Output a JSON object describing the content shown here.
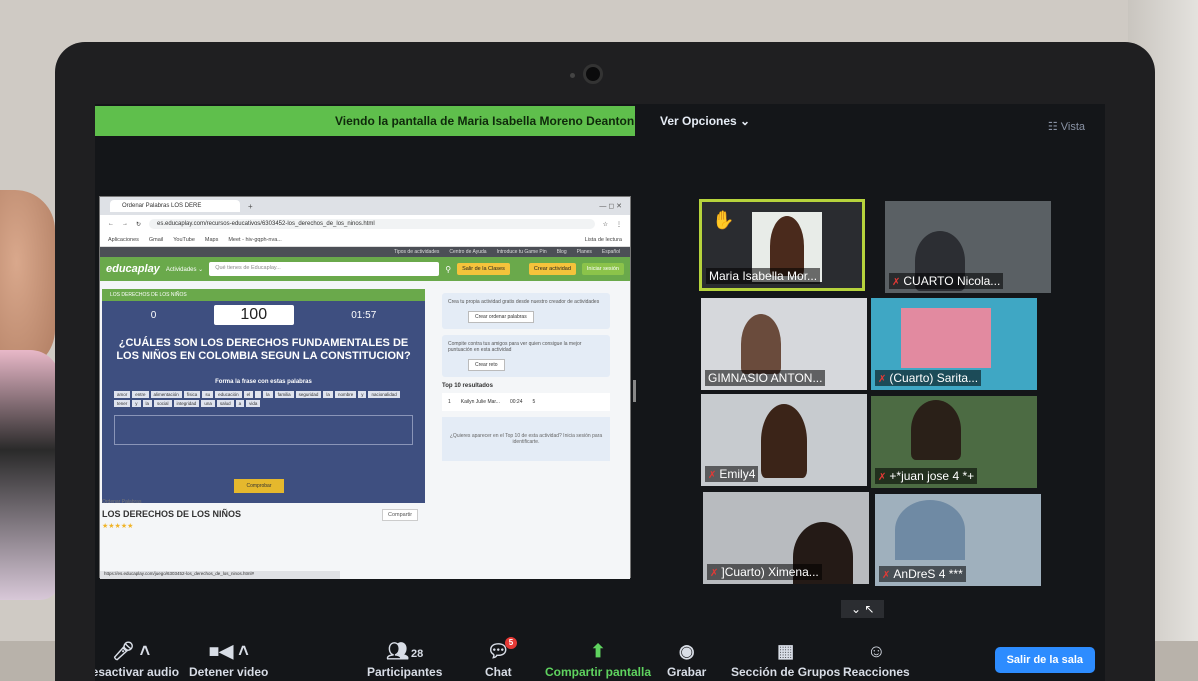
{
  "zoom": {
    "share_banner": "Viendo la pantalla de Maria Isabella Moreno Deantoni...",
    "view_options": "Ver Opciones ⌄",
    "view_label": "Vista"
  },
  "browser": {
    "tab_title": "Ordenar Palabras LOS DERE",
    "url": "es.educaplay.com/recursos-educativos/6303452-los_derechos_de_los_ninos.html",
    "bookmarks": [
      "Aplicaciones",
      "Gmail",
      "YouTube",
      "Maps",
      "Meet - hiv-gqph-nva..."
    ],
    "reading_list": "Lista de lectura",
    "status_url": "https://es.educaplay.com/juego/6303452-los_derechos_de_los_ninos.html#"
  },
  "site": {
    "top_links": [
      "Tipos de actividades",
      "Centro de Ayuda",
      "Introduce tu Game Pin",
      "Blog",
      "Planes",
      "Español"
    ],
    "logo": "educaplay",
    "activities": "Actividades ⌄",
    "search_placeholder": "Qué tienes de Educaplay...",
    "btn_classes": "Salir de la Clases",
    "btn_create": "Crear actividad",
    "btn_login": "Iniciar sesión"
  },
  "game": {
    "header": "LOS DERECHOS DE LOS NIÑOS",
    "left_score": "0",
    "score": "100",
    "time": "01:57",
    "question": "¿CUÁLES SON LOS DERECHOS FUNDAMENTALES DE LOS NIÑOS EN COLOMBIA SEGUN LA CONSTITUCION?",
    "instruction": "Forma la frase con estas palabras",
    "words": [
      "amor",
      "entre",
      "alimentación",
      "física",
      "su",
      "educación",
      "el",
      "",
      "la",
      "familia",
      "seguridad",
      "la",
      "nombre",
      "y",
      "nacionalidad",
      "tener",
      "y",
      "la",
      "social",
      "integridad",
      "una",
      "salud",
      "a",
      "vida"
    ],
    "submit": "Comprobar"
  },
  "below_game": {
    "category": "Ordenar Palabras",
    "title": "LOS DERECHOS DE LOS NIÑOS",
    "stars": "★★★★★",
    "share": "Compartir"
  },
  "sidebar": {
    "card1_text": "Crea tu propia actividad gratis desde nuestro creador de actividades",
    "card1_btn": "Crear ordenar palabras",
    "card2_text": "Compite contra tus amigos para ver quien consigue la mejor puntuación en esta actividad",
    "card2_btn": "Crear reto",
    "top_title": "Top 10 resultados",
    "rank": "1",
    "player": "Kailyn Julie Mar...",
    "player_time": "00:24",
    "player_score": "5",
    "invite": "¿Quieres aparecer en el Top 10 de esta actividad? Inicia sesión para identificarte."
  },
  "gallery": [
    {
      "name": "Maria Isabella Mor...",
      "muted": false
    },
    {
      "name": "CUARTO Nicola...",
      "muted": true
    },
    {
      "name": "GIMNASIO ANTON...",
      "muted": false
    },
    {
      "name": "(Cuarto) Sarita...",
      "muted": true
    },
    {
      "name": "Emily4",
      "muted": true
    },
    {
      "name": "+*juan jose 4 *+",
      "muted": true
    },
    {
      "name": "]Cuarto) Ximena...",
      "muted": true
    },
    {
      "name": "AnDreS 4 ***",
      "muted": true
    }
  ],
  "toolbar": {
    "mute": "Desactivar audio",
    "video": "Detener video",
    "participants": "Participantes",
    "participants_count": "28",
    "chat": "Chat",
    "chat_badge": "5",
    "share": "Compartir pantalla",
    "record": "Grabar",
    "breakout": "Sección de Grupos",
    "reactions": "Reacciones",
    "leave": "Salir de la sala"
  },
  "colors": {
    "zoom_green": "#5fbf4c",
    "leave_blue": "#2d8cff",
    "active_speaker": "#b6d33c",
    "educaplay_green": "#6aa94b"
  }
}
